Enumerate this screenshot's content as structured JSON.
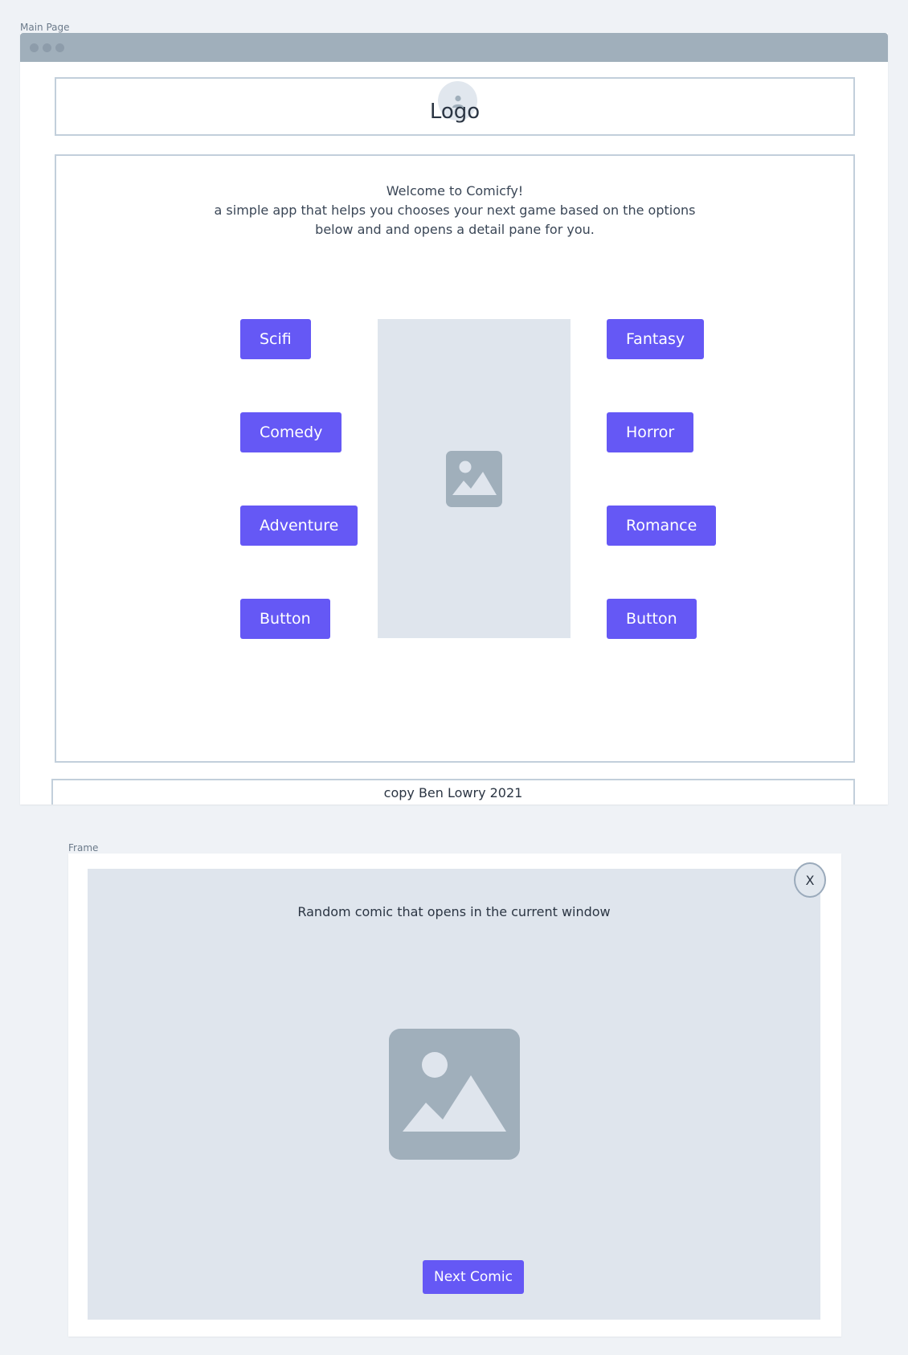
{
  "frames": {
    "main_label": "Main Page",
    "modal_label": "Frame"
  },
  "header": {
    "logo_text": "Logo",
    "avatar_icon": "user-icon"
  },
  "welcome": {
    "line1": "Welcome to Comicfy!",
    "line2": "a simple app that helps you chooses your next game based  on the options",
    "line3": "below and and opens a detail pane for you."
  },
  "genres": {
    "left": [
      "Scifi",
      "Comedy",
      "Adventure",
      "Button"
    ],
    "right": [
      "Fantasy",
      "Horror",
      "Romance",
      "Button"
    ]
  },
  "center_image_icon": "image-placeholder-icon",
  "footer": {
    "text": "copy Ben Lowry 2021"
  },
  "modal": {
    "description": "Random comic that opens in the current window",
    "close_label": "X",
    "next_label": "Next Comic",
    "image_icon": "image-placeholder-icon"
  },
  "colors": {
    "accent": "#6558f5",
    "placeholder_bg": "#dfe5ed",
    "placeholder_icon": "#a0afbb",
    "border": "#c2cfdb",
    "titlebar": "#a0afbb"
  }
}
